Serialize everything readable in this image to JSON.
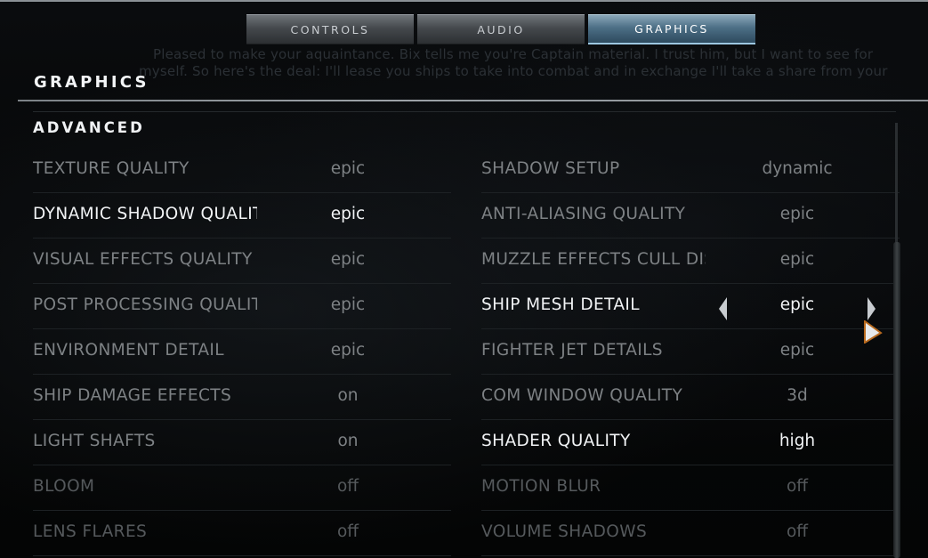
{
  "tabs": [
    {
      "label": "CONTROLS",
      "active": false
    },
    {
      "label": "AUDIO",
      "active": false
    },
    {
      "label": "GRAPHICS",
      "active": true
    }
  ],
  "background_text": {
    "line1": "Pleased to make your aquaintance. Bix tells me you're Captain material. I trust him, but I want to see for",
    "line2": "myself. So here's the deal: I'll lease you ships to take into combat and in exchange I'll take a share from your"
  },
  "page_title": "GRAPHICS",
  "section_title": "ADVANCED",
  "left_settings": [
    {
      "label": "TEXTURE QUALITY",
      "value": "epic"
    },
    {
      "label": "DYNAMIC SHADOW QUALITY",
      "value": "epic"
    },
    {
      "label": "VISUAL EFFECTS QUALITY",
      "value": "epic"
    },
    {
      "label": "POST PROCESSING QUALITY",
      "value": "epic"
    },
    {
      "label": "ENVIRONMENT DETAIL",
      "value": "epic"
    },
    {
      "label": "SHIP DAMAGE EFFECTS",
      "value": "on"
    },
    {
      "label": "LIGHT SHAFTS",
      "value": "on"
    },
    {
      "label": "BLOOM",
      "value": "off"
    },
    {
      "label": "LENS FLARES",
      "value": "off"
    }
  ],
  "right_settings": [
    {
      "label": "SHADOW SETUP",
      "value": "dynamic"
    },
    {
      "label": "ANTI-ALIASING QUALITY",
      "value": "epic"
    },
    {
      "label": "MUZZLE EFFECTS CULL DISTANCE",
      "value": "epic"
    },
    {
      "label": "SHIP MESH DETAIL",
      "value": "epic"
    },
    {
      "label": "FIGHTER JET DETAILS",
      "value": "epic"
    },
    {
      "label": "COM WINDOW QUALITY",
      "value": "3d"
    },
    {
      "label": "SHADER QUALITY",
      "value": "high"
    },
    {
      "label": "MOTION BLUR",
      "value": "off"
    },
    {
      "label": "VOLUME SHADOWS",
      "value": "off"
    }
  ],
  "colors": {
    "accent_tab": "#4d6f86",
    "text_bright": "#f1f3f5",
    "text_normal": "#7d8184",
    "text_dim": "#55595c"
  }
}
